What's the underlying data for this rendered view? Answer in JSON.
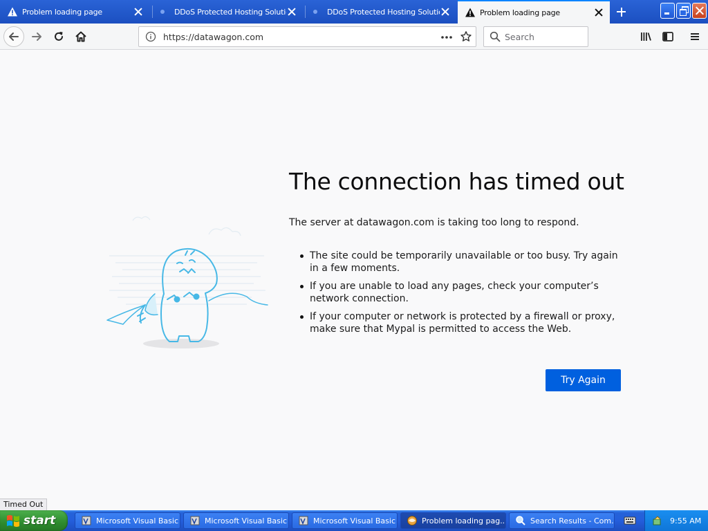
{
  "tabs": [
    {
      "title": "Problem loading page",
      "icon": "warning-icon",
      "active": false
    },
    {
      "title": "DDoS Protected Hosting Solutions",
      "icon": "loading-dot-icon",
      "active": false
    },
    {
      "title": "DDoS Protected Hosting Solutions",
      "icon": "loading-dot-icon",
      "active": false
    },
    {
      "title": "Problem loading page",
      "icon": "warning-icon",
      "active": true
    }
  ],
  "toolbar": {
    "url": "https://datawagon.com",
    "search_placeholder": "Search"
  },
  "error": {
    "title": "The connection has timed out",
    "description": "The server at datawagon.com is taking too long to respond.",
    "reasons": [
      "The site could be temporarily unavailable or too busy. Try again in a few moments.",
      "If you are unable to load any pages, check your computer’s network connection.",
      "If your computer or network is protected by a firewall or proxy, make sure that Mypal is permitted to access the Web."
    ],
    "try_again_label": "Try Again"
  },
  "status_text": "Timed Out",
  "taskbar": {
    "start_label": "start",
    "items": [
      {
        "label": "Microsoft Visual Basic",
        "active": false
      },
      {
        "label": "Microsoft Visual Basic",
        "active": false
      },
      {
        "label": "Microsoft Visual Basic",
        "active": false
      },
      {
        "label": "Problem loading pag...",
        "active": true
      },
      {
        "label": "Search Results - Com...",
        "active": false
      }
    ],
    "clock": "9:55 AM"
  },
  "colors": {
    "accent": "#0060df",
    "tab_strip": "#245edb",
    "illustration": "#47b8e6"
  }
}
